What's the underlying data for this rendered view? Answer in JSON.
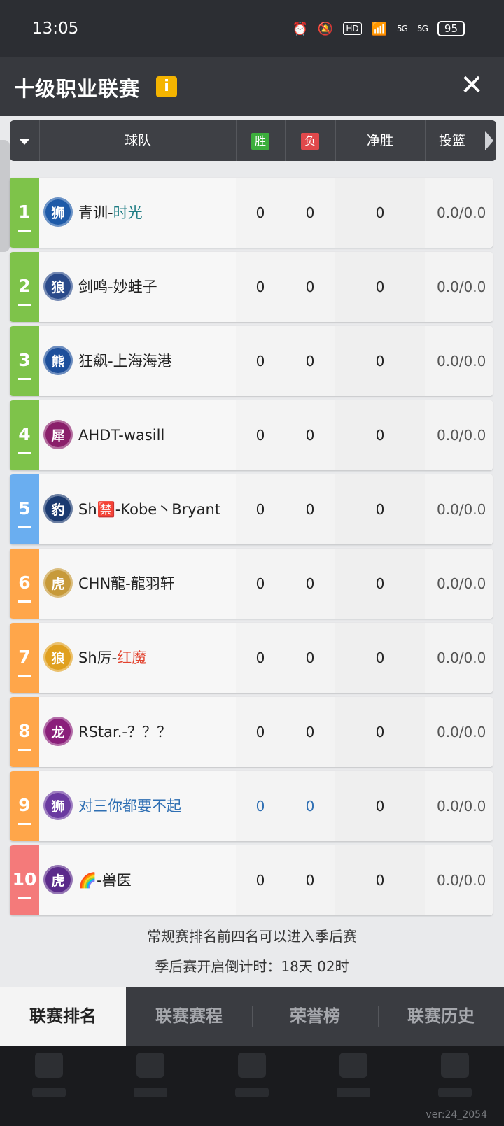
{
  "status_bar": {
    "time": "13:05",
    "hd_label": "HD",
    "signal_1": "5G",
    "signal_2": "5G",
    "battery": "95",
    "icons": [
      "alarm-icon",
      "mute-icon",
      "hd-icon",
      "wifi-icon",
      "signal-5g-icon",
      "signal-5g-icon",
      "battery-icon"
    ]
  },
  "header": {
    "title": "十级职业联赛",
    "info_label": "i",
    "close_label": "✕"
  },
  "table_header": {
    "team": "球队",
    "win": "胜",
    "loss": "负",
    "net_win": "净胜",
    "shot": "投篮"
  },
  "rows": [
    {
      "rank": "1",
      "team_prefix": "青训-",
      "team_highlight": "时光",
      "highlight": "teal",
      "win": "0",
      "loss": "0",
      "net": "0",
      "shot": "0.0/0.0",
      "rank_color": "#7ec34a",
      "logo_color": "#1e5aa8",
      "logo_letter": "狮"
    },
    {
      "rank": "2",
      "team_prefix": "剑鸣-妙蛙子",
      "team_highlight": "",
      "highlight": "",
      "win": "0",
      "loss": "0",
      "net": "0",
      "shot": "0.0/0.0",
      "rank_color": "#7ec34a",
      "logo_color": "#2a4a8a",
      "logo_letter": "狼"
    },
    {
      "rank": "3",
      "team_prefix": "狂飙-上海海港",
      "team_highlight": "",
      "highlight": "",
      "win": "0",
      "loss": "0",
      "net": "0",
      "shot": "0.0/0.0",
      "rank_color": "#7ec34a",
      "logo_color": "#1d4f9b",
      "logo_letter": "熊"
    },
    {
      "rank": "4",
      "team_prefix": "AHDT-wasill",
      "team_highlight": "",
      "highlight": "",
      "win": "0",
      "loss": "0",
      "net": "0",
      "shot": "0.0/0.0",
      "rank_color": "#7ec34a",
      "logo_color": "#8a1f6a",
      "logo_letter": "犀"
    },
    {
      "rank": "5",
      "team_prefix": "Sh🈲-Kobe丶Bryant",
      "team_highlight": "",
      "highlight": "",
      "win": "0",
      "loss": "0",
      "net": "0",
      "shot": "0.0/0.0",
      "rank_color": "#6aaef0",
      "logo_color": "#1b3a70",
      "logo_letter": "豹"
    },
    {
      "rank": "6",
      "team_prefix": "CHN龍-龍羽轩",
      "team_highlight": "",
      "highlight": "",
      "win": "0",
      "loss": "0",
      "net": "0",
      "shot": "0.0/0.0",
      "rank_color": "#ffa64a",
      "logo_color": "#c79a3a",
      "logo_letter": "虎"
    },
    {
      "rank": "7",
      "team_prefix": "Sh厉-",
      "team_highlight": "红魔",
      "highlight": "red",
      "win": "0",
      "loss": "0",
      "net": "0",
      "shot": "0.0/0.0",
      "rank_color": "#ffa64a",
      "logo_color": "#e0a020",
      "logo_letter": "狼"
    },
    {
      "rank": "8",
      "team_prefix": "RStar.-？？？",
      "team_highlight": "",
      "highlight": "",
      "win": "0",
      "loss": "0",
      "net": "0",
      "shot": "0.0/0.0",
      "rank_color": "#ffa64a",
      "logo_color": "#8a1f7a",
      "logo_letter": "龙"
    },
    {
      "rank": "9",
      "team_prefix": "对三你都要不起",
      "team_highlight": "",
      "highlight": "blue",
      "win": "0",
      "loss": "0",
      "net": "0",
      "shot": "0.0/0.0",
      "rank_color": "#ffa64a",
      "logo_color": "#6a3aa0",
      "logo_letter": "狮"
    },
    {
      "rank": "10",
      "team_prefix": "🌈-兽医",
      "team_highlight": "",
      "highlight": "",
      "win": "0",
      "loss": "0",
      "net": "0",
      "shot": "0.0/0.0",
      "rank_color": "#f47a7a",
      "logo_color": "#5a2a8a",
      "logo_letter": "虎"
    }
  ],
  "notes": {
    "line1": "常规赛排名前四名可以进入季后赛",
    "line2": "季后赛开启倒计时：18天 02时"
  },
  "tabs": [
    "联赛排名",
    "联赛赛程",
    "荣誉榜",
    "联赛历史"
  ],
  "version": "ver:24_2054"
}
